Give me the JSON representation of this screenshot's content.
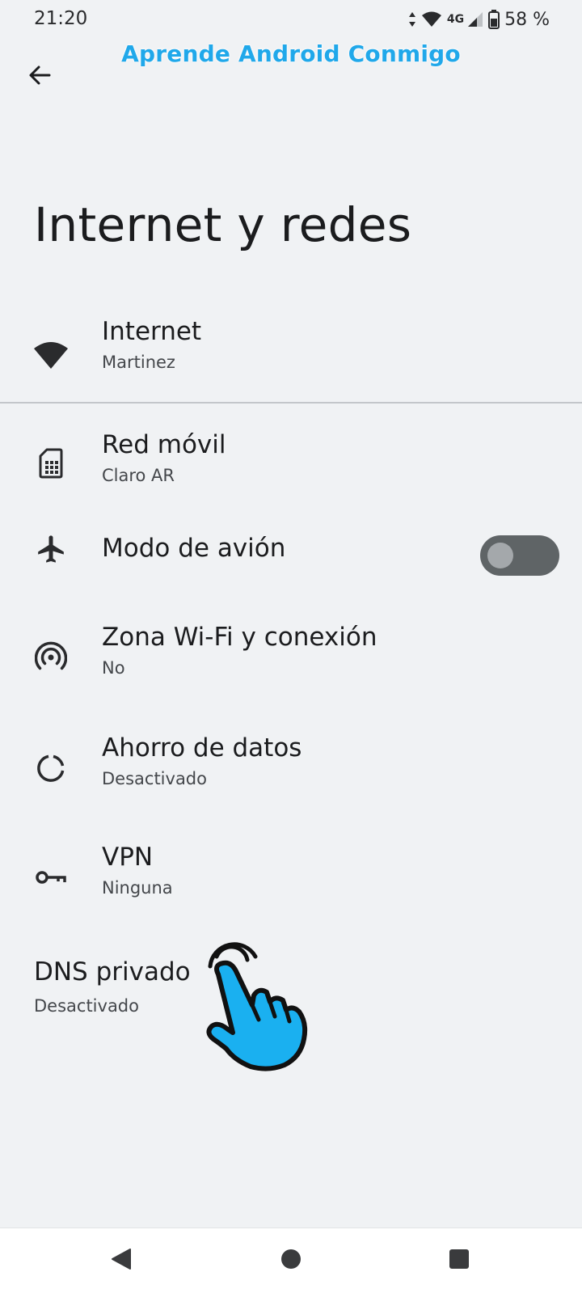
{
  "status_bar": {
    "time": "21:20",
    "network": "4G",
    "battery": "58 %"
  },
  "watermark": "Aprende Android Conmigo",
  "header": {
    "title": "Internet y redes"
  },
  "items": [
    {
      "title": "Internet",
      "subtitle": "Martinez",
      "icon": "wifi-icon"
    },
    {
      "title": "Red móvil",
      "subtitle": "Claro AR",
      "icon": "sim-card-icon"
    },
    {
      "title": "Modo de avión",
      "icon": "airplane-icon",
      "toggle_on": false
    },
    {
      "title": "Zona Wi-Fi y conexión",
      "subtitle": "No",
      "icon": "hotspot-icon"
    },
    {
      "title": "Ahorro de datos",
      "subtitle": "Desactivado",
      "icon": "data-saver-icon"
    },
    {
      "title": "VPN",
      "subtitle": "Ninguna",
      "icon": "vpn-key-icon"
    }
  ],
  "dns": {
    "title": "DNS privado",
    "subtitle": "Desactivado"
  },
  "colors": {
    "background": "#f0f2f4",
    "watermark": "#20a8ea",
    "toggle_track": "#5f6466",
    "hand_fill": "#1ab0f0"
  }
}
